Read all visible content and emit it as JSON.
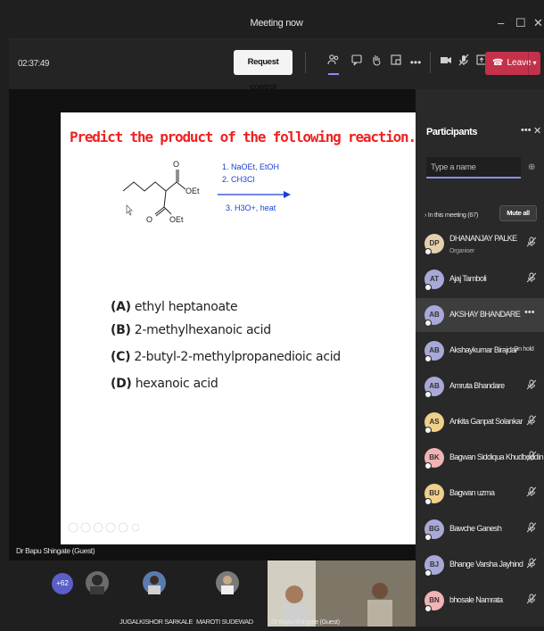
{
  "window": {
    "title": "Meeting now",
    "minimize_glyph": "–",
    "maximize_glyph": "☐",
    "close_glyph": "✕"
  },
  "toolbar": {
    "timer": "02:37:49",
    "request_control": "Request control",
    "icons": [
      "people-icon",
      "chat-icon",
      "raise-hand-icon",
      "rooms-icon",
      "more-icon",
      "camera-icon",
      "mic-off-icon",
      "share-icon"
    ],
    "leave_label": "Leave",
    "leave_color": "#c4314b",
    "accent_color": "#8b8cf0"
  },
  "slide": {
    "question": "Predict the product of the following reaction.",
    "reagents": [
      "1. NaOEt, EtOH",
      "2. CH3Cl",
      "3. H3O+, heat"
    ],
    "molecule_labels": [
      "O",
      "OEt",
      "O",
      "OEt"
    ],
    "options": [
      {
        "letter": "(A)",
        "text": "ethyl heptanoate"
      },
      {
        "letter": "(B)",
        "text": "2-methylhexanoic acid"
      },
      {
        "letter": "(C)",
        "text": "2-butyl-2-methylpropanedioic acid"
      },
      {
        "letter": "(D)",
        "text": "hexanoic acid"
      }
    ],
    "question_color": "#ee2222",
    "arrow_color": "#1a3ed6"
  },
  "stage": {
    "speaker": "Dr Bapu Shingate (Guest)",
    "overflow_count": "+62",
    "tiles": [
      "JUGALKISHOR SARKALE",
      "MAROTI SUDEWAD",
      "Dr Bapu Shingate (Guest)"
    ]
  },
  "panel": {
    "title": "Participants",
    "search_placeholder": "Type a name",
    "section_label": "In this meeting (67)",
    "mute_all": "Mute all",
    "participants": [
      {
        "initials": "DP",
        "name": "DHANANJAY PALKE",
        "role": "Organiser",
        "color": "#e6cfae",
        "status": "mic-off"
      },
      {
        "initials": "AT",
        "name": "Ajaj Tamboli",
        "role": "",
        "color": "#a8a9d8",
        "status": "mic-off"
      },
      {
        "initials": "AB",
        "name": "AKSHAY BHANDARE",
        "role": "",
        "color": "#a8a9d8",
        "status": "more"
      },
      {
        "initials": "AB",
        "name": "Akshaykumar Birajdar",
        "role": "",
        "color": "#a8a9d8",
        "status": "On hold"
      },
      {
        "initials": "AB",
        "name": "Amruta Bhandare",
        "role": "",
        "color": "#a8a9d8",
        "status": "mic-off"
      },
      {
        "initials": "AS",
        "name": "Ankita Ganpat Solankar",
        "role": "",
        "color": "#f0d08a",
        "status": "mic-off"
      },
      {
        "initials": "BK",
        "name": "Bagwan Siddiqua Khudboddin",
        "role": "",
        "color": "#f2b3b6",
        "status": "mic-off"
      },
      {
        "initials": "BU",
        "name": "Bagwan uzma",
        "role": "",
        "color": "#f0d08a",
        "status": "mic-off"
      },
      {
        "initials": "BG",
        "name": "Bawche Ganesh",
        "role": "",
        "color": "#a8a9d8",
        "status": "mic-off"
      },
      {
        "initials": "BJ",
        "name": "Bhange Varsha Jayhind",
        "role": "",
        "color": "#a8a9d8",
        "status": "mic-off"
      },
      {
        "initials": "BN",
        "name": "bhosale Namrata",
        "role": "",
        "color": "#f2b3b6",
        "status": "mic-off"
      }
    ]
  }
}
